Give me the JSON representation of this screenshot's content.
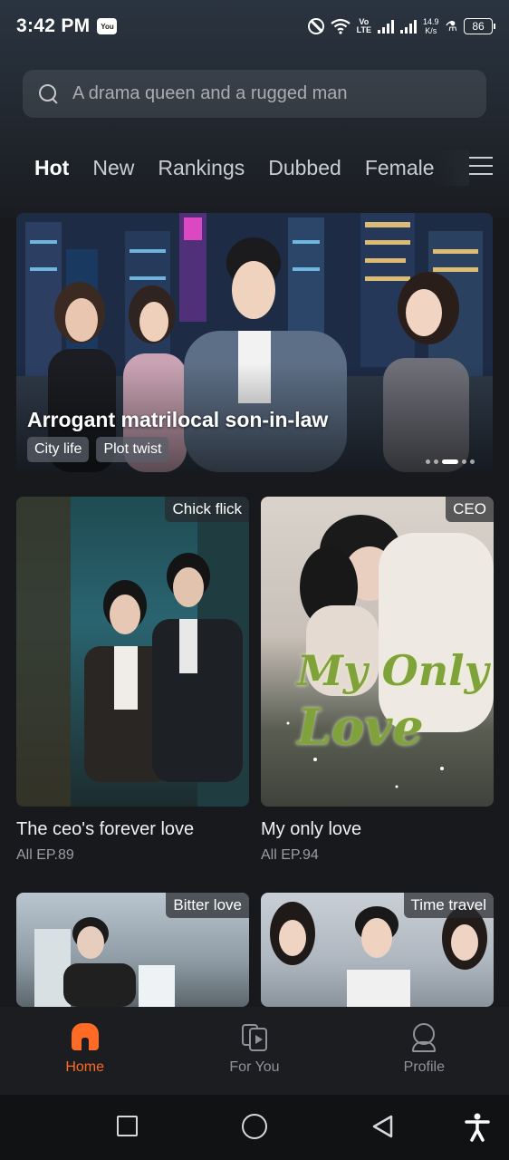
{
  "status_bar": {
    "time": "3:42 PM",
    "app_icon_label": "You",
    "network_label_top": "Vo",
    "network_label_bottom": "LTE",
    "speed_top": "14.9",
    "speed_bottom": "K/s",
    "battery": "86"
  },
  "search": {
    "placeholder": "A drama queen and a rugged man",
    "icon": "search-icon"
  },
  "tabs": [
    {
      "label": "Hot",
      "active": true
    },
    {
      "label": "New",
      "active": false
    },
    {
      "label": "Rankings",
      "active": false
    },
    {
      "label": "Dubbed",
      "active": false
    },
    {
      "label": "Female",
      "active": false
    }
  ],
  "banner": {
    "title": "Arrogant matrilocal son-in-law",
    "tags": [
      "City life",
      "Plot twist"
    ],
    "slide_index": 3,
    "slide_count": 5
  },
  "cards": [
    {
      "title": "The ceo's forever love",
      "episodes": "All EP.89",
      "badge": "Chick flick"
    },
    {
      "title": "My only love",
      "episodes": "All EP.94",
      "badge": "CEO",
      "poster_text_1": "My Only",
      "poster_text_2": "Love"
    },
    {
      "title": "",
      "episodes": "",
      "badge": "Bitter love"
    },
    {
      "title": "",
      "episodes": "",
      "badge": "Time travel"
    }
  ],
  "bottom_nav": [
    {
      "label": "Home",
      "icon": "home-icon",
      "active": true
    },
    {
      "label": "For You",
      "icon": "play-cards-icon",
      "active": false
    },
    {
      "label": "Profile",
      "icon": "profile-icon",
      "active": false
    }
  ],
  "colors": {
    "accent": "#ff6a24",
    "background": "#18191c"
  }
}
